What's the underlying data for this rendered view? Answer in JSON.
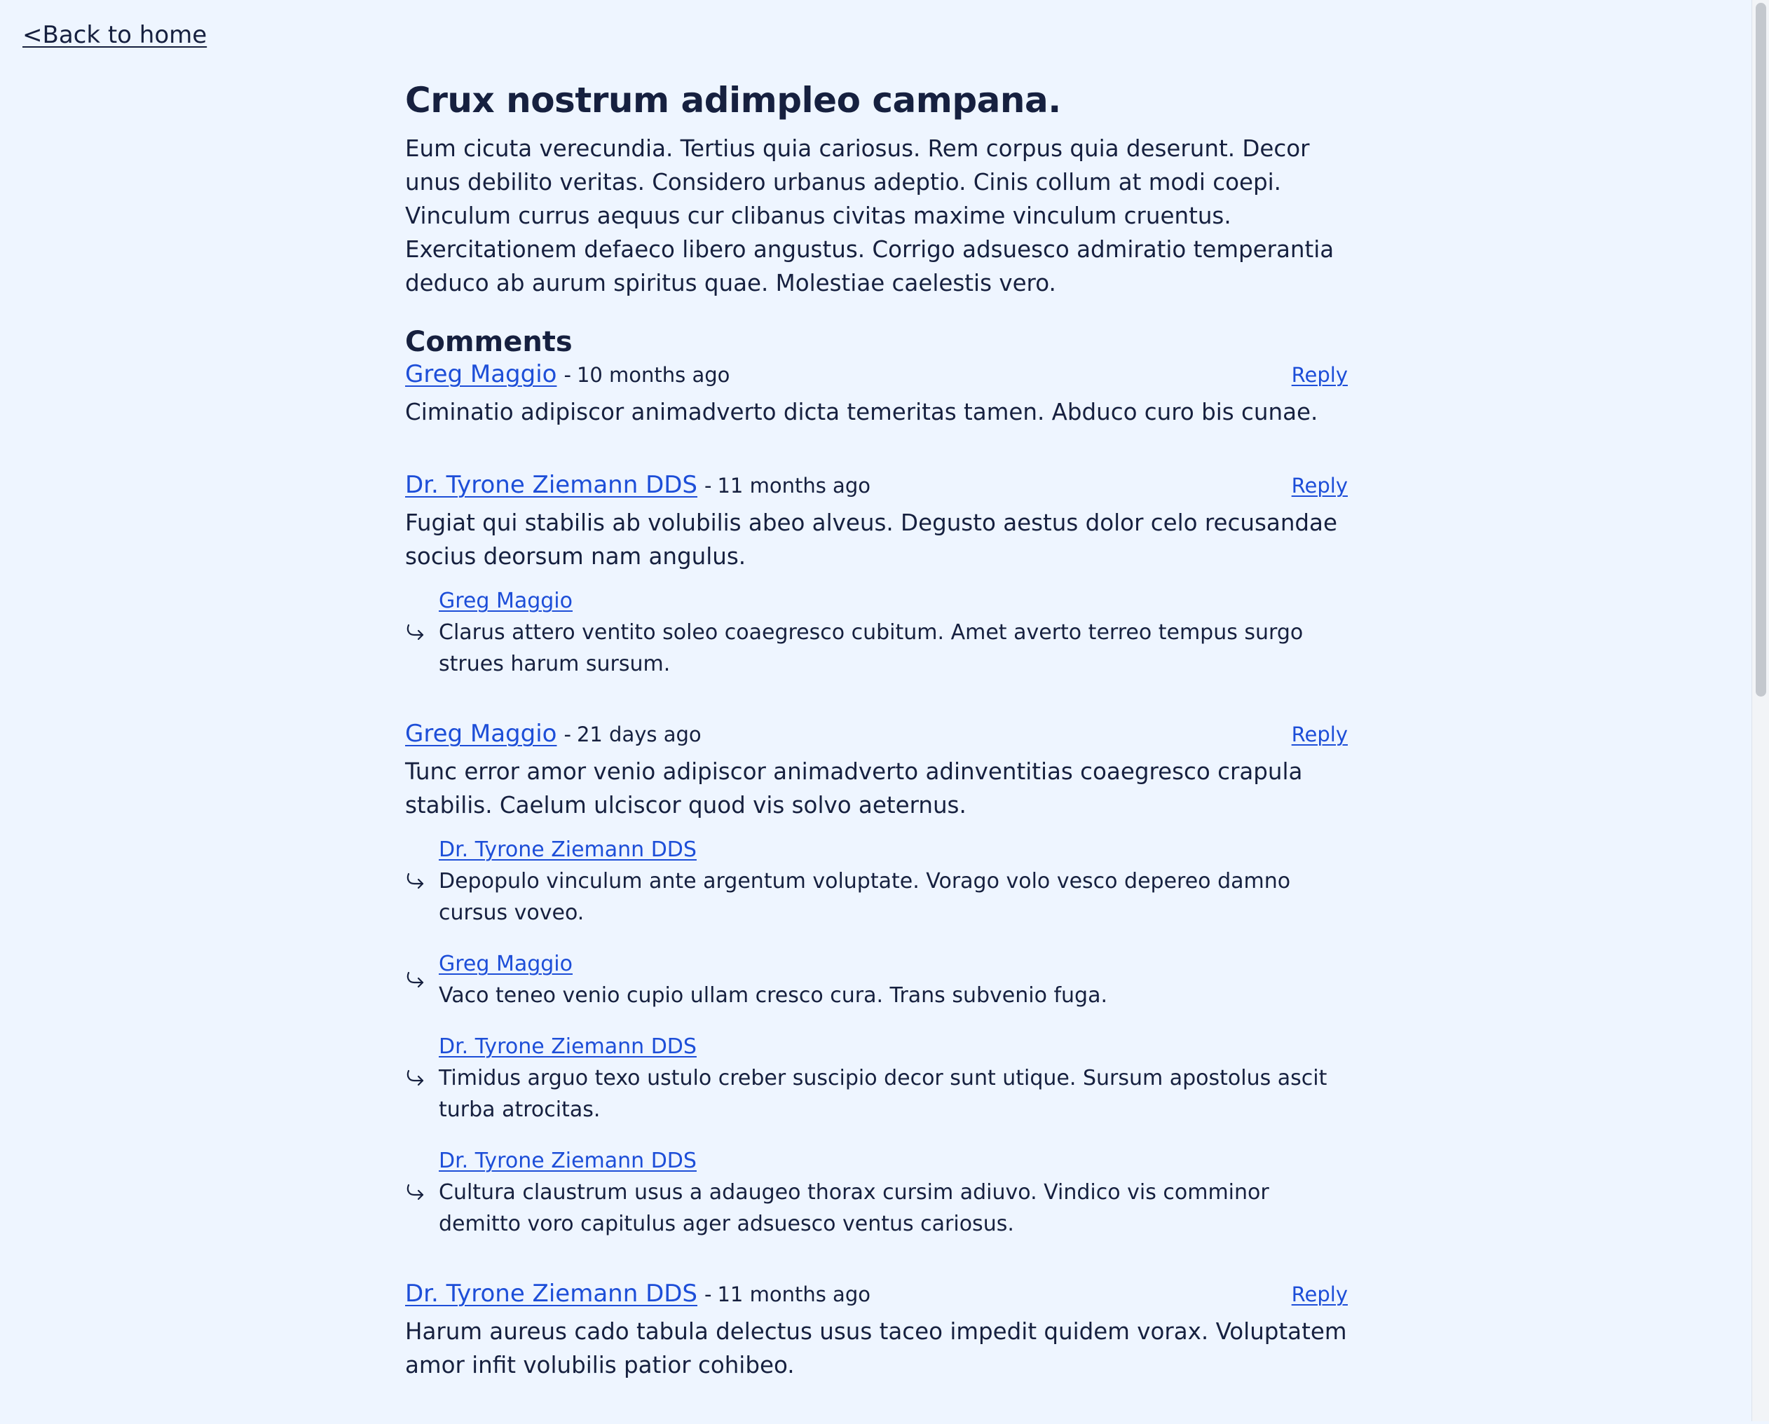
{
  "nav": {
    "back_label": "<Back to home"
  },
  "post": {
    "title": "Crux nostrum adimpleo campana.",
    "body": "Eum cicuta verecundia. Tertius quia cariosus. Rem corpus quia deserunt. Decor unus debilito veritas. Considero urbanus adeptio. Cinis collum at modi coepi. Vinculum currus aequus cur clibanus civitas maxime vinculum cruentus. Exercitationem defaeco libero angustus. Corrigo adsuesco admiratio temperantia deduco ab aurum spiritus quae. Molestiae caelestis vero."
  },
  "comments_heading": "Comments",
  "separator": "-",
  "reply_label": "Reply",
  "comments": [
    {
      "author": "Greg Maggio",
      "time": "10 months ago",
      "text": "Ciminatio adipiscor animadverto dicta temeritas tamen. Abduco curo bis cunae.",
      "replies": []
    },
    {
      "author": "Dr. Tyrone Ziemann DDS",
      "time": "11 months ago",
      "text": "Fugiat qui stabilis ab volubilis abeo alveus. Degusto aestus dolor celo recusandae socius deorsum nam angulus.",
      "replies": [
        {
          "author": "Greg Maggio",
          "text": "Clarus attero ventito soleo coaegresco cubitum. Amet averto terreo tempus surgo strues harum sursum."
        }
      ]
    },
    {
      "author": "Greg Maggio",
      "time": "21 days ago",
      "text": "Tunc error amor venio adipiscor animadverto adinventitias coaegresco crapula stabilis. Caelum ulciscor quod vis solvo aeternus.",
      "replies": [
        {
          "author": "Dr. Tyrone Ziemann DDS",
          "text": "Depopulo vinculum ante argentum voluptate. Vorago volo vesco depereo damno cursus voveo."
        },
        {
          "author": "Greg Maggio",
          "text": "Vaco teneo venio cupio ullam cresco cura. Trans subvenio fuga."
        },
        {
          "author": "Dr. Tyrone Ziemann DDS",
          "text": "Timidus arguo texo ustulo creber suscipio decor sunt utique. Sursum apostolus ascit turba atrocitas."
        },
        {
          "author": "Dr. Tyrone Ziemann DDS",
          "text": "Cultura claustrum usus a adaugeo thorax cursim adiuvo. Vindico vis comminor demitto voro capitulus ager adsuesco ventus cariosus."
        }
      ]
    },
    {
      "author": "Dr. Tyrone Ziemann DDS",
      "time": "11 months ago",
      "text": "Harum aureus cado tabula delectus usus taceo impedit quidem vorax. Voluptatem amor infit volubilis patior cohibeo.",
      "replies": []
    }
  ],
  "icons": {
    "reply_arrow": "reply-arrow-icon"
  },
  "colors": {
    "background": "#eef5ff",
    "text": "#16203f",
    "link": "#1d4ed8"
  }
}
